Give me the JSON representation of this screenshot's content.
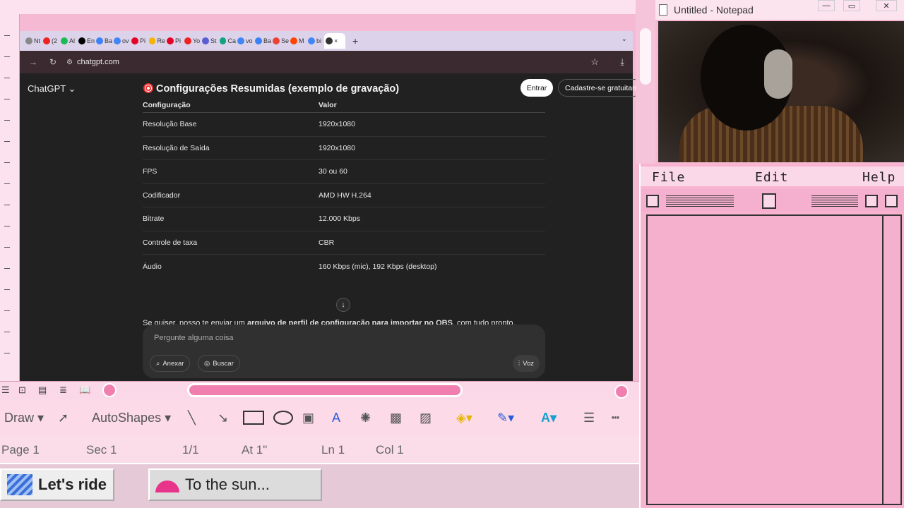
{
  "browser": {
    "tabs": [
      {
        "short": "Nt",
        "color": "#888"
      },
      {
        "short": "(2",
        "color": "#e22"
      },
      {
        "short": "Al",
        "color": "#1db954"
      },
      {
        "short": "En",
        "color": "#000"
      },
      {
        "short": "Ba",
        "color": "#3b82f6"
      },
      {
        "short": "ov",
        "color": "#4285f4"
      },
      {
        "short": "Pi",
        "color": "#e60023"
      },
      {
        "short": "Re",
        "color": "#f5b400"
      },
      {
        "short": "Pi",
        "color": "#e60023"
      },
      {
        "short": "Yo",
        "color": "#e22"
      },
      {
        "short": "St",
        "color": "#5b5bd6"
      },
      {
        "short": "Ca",
        "color": "#10a37f"
      },
      {
        "short": "vo",
        "color": "#4285f4"
      },
      {
        "short": "Ba",
        "color": "#3b82f6"
      },
      {
        "short": "Se",
        "color": "#ea4335"
      },
      {
        "short": "M",
        "color": "#ff4500"
      },
      {
        "short": "bi",
        "color": "#4285f4"
      }
    ],
    "active_tab_close": "×",
    "new_tab": "+",
    "url": "chatgpt.com"
  },
  "chatgpt": {
    "brand": "ChatGPT ⌄",
    "heading": "Configurações Resumidas (exemplo de gravação)",
    "login_button": "Entrar",
    "signup_button": "Cadastre-se gratuitamente",
    "table": {
      "headers": [
        "Configuração",
        "Valor"
      ],
      "rows": [
        [
          "Resolução Base",
          "1920x1080"
        ],
        [
          "Resolução de Saída",
          "1920x1080"
        ],
        [
          "FPS",
          "30 ou 60"
        ],
        [
          "Codificador",
          "AMD HW H.264"
        ],
        [
          "Bitrate",
          "12.000 Kbps"
        ],
        [
          "Controle de taxa",
          "CBR"
        ],
        [
          "Áudio",
          "160 Kbps (mic), 192 Kbps (desktop)"
        ]
      ]
    },
    "paragraph_start": "Se quiser, posso te enviar um ",
    "paragraph_bold": "arquivo de perfil de configuração para importar no OBS",
    "paragraph_end": ", com tudo pronto.",
    "prompt_placeholder": "Pergunte alguma coisa",
    "attach_label": "Anexar",
    "search_label": "Buscar",
    "voice_label": "Voz"
  },
  "word": {
    "draw_label": "Draw ▾",
    "autoshapes_label": "AutoShapes ▾",
    "status": {
      "page": "Page  1",
      "sec": "Sec  1",
      "of": "1/1",
      "at": "At  1\"",
      "ln": "Ln  1",
      "col": "Col  1"
    }
  },
  "taskbar": {
    "task1": "Let's ride",
    "task2": "To the sun..."
  },
  "notepad": {
    "title": "Untitled - Notepad",
    "menu": {
      "file": "File",
      "edit": "Edit",
      "help": "Help"
    }
  }
}
